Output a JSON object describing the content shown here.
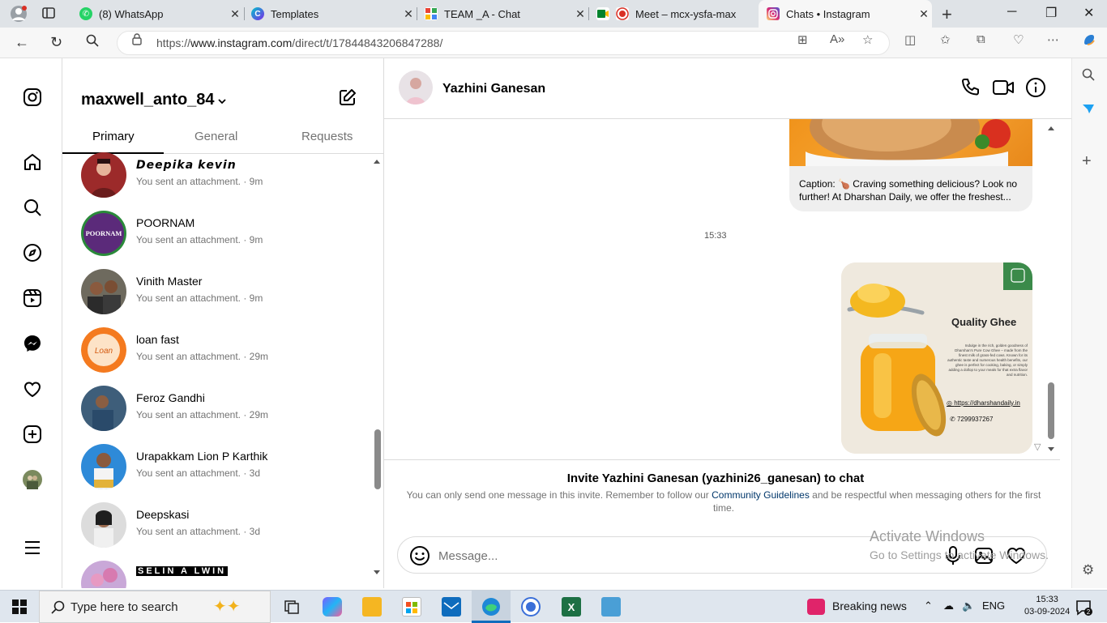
{
  "browser": {
    "tabs": [
      {
        "title": "(8) WhatsApp",
        "favicon": "whatsapp-icon",
        "active": false
      },
      {
        "title": "Templates",
        "favicon": "canva-icon",
        "active": false
      },
      {
        "title": "TEAM _A - Chat",
        "favicon": "google-chat-icon",
        "active": false
      },
      {
        "title": "Meet – mcx-ysfa-max",
        "favicon": "google-meet-icon",
        "active": false
      },
      {
        "title": "Chats • Instagram",
        "favicon": "instagram-icon",
        "active": true
      }
    ],
    "url_prefix": "https://",
    "url_host": "www.instagram.com",
    "url_path": "/direct/t/17844843206847288/"
  },
  "inbox": {
    "username": "maxwell_anto_84",
    "tabs": [
      "Primary",
      "General",
      "Requests"
    ],
    "conversations": [
      {
        "name": "𝘿𝙚𝙚𝙥𝙞𝙠𝙖 𝙠𝙚𝙫𝙞𝙣",
        "subtitle": "You sent an attachment. · 9m"
      },
      {
        "name": "POORNAM",
        "subtitle": "You sent an attachment. · 9m"
      },
      {
        "name": "Vinith Master",
        "subtitle": "You sent an attachment. · 9m"
      },
      {
        "name": "loan fast",
        "subtitle": "You sent an attachment. · 29m"
      },
      {
        "name": "Feroz Gandhi",
        "subtitle": "You sent an attachment. · 29m"
      },
      {
        "name": "Urapakkam Lion P Karthik",
        "subtitle": "You sent an attachment. · 3d"
      },
      {
        "name": "Deepskasi",
        "subtitle": "You sent an attachment. · 3d"
      },
      {
        "name": "SELIN A LWIN",
        "subtitle": ""
      }
    ]
  },
  "chat": {
    "contact_name": "Yazhini Ganesan",
    "caption": "Caption: 🍗 Craving something delicious? Look no further! At Dharshan Daily, we offer the freshest...",
    "time_divider": "15:33",
    "ghee_ad": {
      "heading": "Quality Ghee",
      "body": "Indulge in the rich, golden goodness of Dharshan's Pure Cow Ghee – made from the finest milk of grass-fed cows. Known for its authentic taste and numerous health benefits, our ghee is perfect for cooking, baking, or simply adding a dollop to your meals for that extra flavor and nutrition.",
      "website": "https://dharshandaily.in",
      "phone": "7299937267"
    },
    "invite_title": "Invite Yazhini Ganesan (yazhini26_ganesan) to chat",
    "invite_text_before": "You can only send one message in this invite. Remember to follow our ",
    "invite_link": "Community Guidelines",
    "invite_text_after": " and be respectful when messaging others for the first time.",
    "message_placeholder": "Message..."
  },
  "watermark": {
    "line1": "Activate Windows",
    "line2": "Go to Settings to activate Windows."
  },
  "taskbar": {
    "search_placeholder": "Type here to search",
    "news": "Breaking news",
    "language": "ENG",
    "time": "15:33",
    "date": "03-09-2024"
  },
  "colors": {
    "accent_link": "#00376b",
    "muted_text": "#737373",
    "border": "#dbdbdb"
  }
}
